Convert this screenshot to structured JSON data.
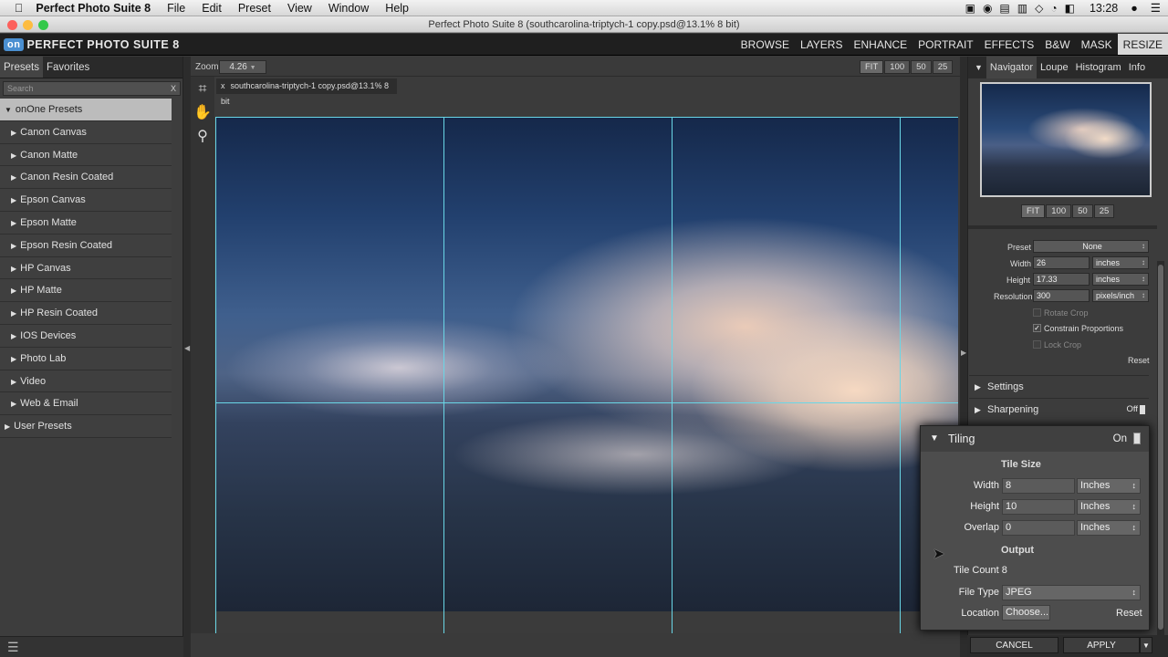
{
  "mac_menu": {
    "apple": "",
    "app": "Perfect Photo Suite 8",
    "items": [
      "File",
      "Edit",
      "Preset",
      "View",
      "Window",
      "Help"
    ],
    "time": "13:28"
  },
  "window_title": "Perfect Photo Suite 8 (southcarolina-triptych-1 copy.psd@13.1% 8 bit)",
  "app_logo": {
    "badge": "on",
    "text": "PERFECT PHOTO SUITE 8"
  },
  "modules": [
    "BROWSE",
    "LAYERS",
    "ENHANCE",
    "PORTRAIT",
    "EFFECTS",
    "B&W",
    "MASK",
    "RESIZE"
  ],
  "active_module": "RESIZE",
  "left_panel": {
    "tabs": [
      "Presets",
      "Favorites"
    ],
    "search_placeholder": "Search",
    "group": "onOne Presets",
    "items": [
      "Canon Canvas",
      "Canon Matte",
      "Canon Resin Coated",
      "Epson Canvas",
      "Epson Matte",
      "Epson Resin Coated",
      "HP Canvas",
      "HP Matte",
      "HP Resin Coated",
      "IOS Devices",
      "Photo Lab",
      "Video",
      "Web & Email"
    ],
    "user_group": "User Presets"
  },
  "canvas": {
    "zoom_label": "Zoom",
    "zoom_value": "4.26",
    "zoom_buttons": [
      "FIT",
      "100",
      "50",
      "25"
    ],
    "doc_tab": "southcarolina-triptych-1 copy.psd@13.1% 8 bit",
    "doc_close": "x"
  },
  "right_panel": {
    "tabs": [
      "Navigator",
      "Loupe",
      "Histogram",
      "Info"
    ],
    "nav_buttons": [
      "FIT",
      "100",
      "50",
      "25"
    ],
    "preset_label": "Preset",
    "preset_value": "None",
    "width_label": "Width",
    "width_value": "26",
    "width_unit": "inches",
    "height_label": "Height",
    "height_value": "17.33",
    "height_unit": "inches",
    "resolution_label": "Resolution",
    "resolution_value": "300",
    "resolution_unit": "pixels/inch",
    "rotate_crop": "Rotate Crop",
    "constrain": "Constrain Proportions",
    "lock_crop": "Lock Crop",
    "reset": "Reset",
    "settings": "Settings",
    "sharpening": "Sharpening",
    "sharpening_state": "Off"
  },
  "tiling": {
    "title": "Tiling",
    "state": "On",
    "tile_size": "Tile Size",
    "width_label": "Width",
    "width_value": "8",
    "width_unit": "Inches",
    "height_label": "Height",
    "height_value": "10",
    "height_unit": "Inches",
    "overlap_label": "Overlap",
    "overlap_value": "0",
    "overlap_unit": "Inches",
    "output": "Output",
    "tile_count": "Tile Count 8",
    "file_type_label": "File Type",
    "file_type_value": "JPEG",
    "location_label": "Location",
    "location_value": "Choose...",
    "reset": "Reset"
  },
  "footer": {
    "cancel": "CANCEL",
    "apply": "APPLY"
  }
}
